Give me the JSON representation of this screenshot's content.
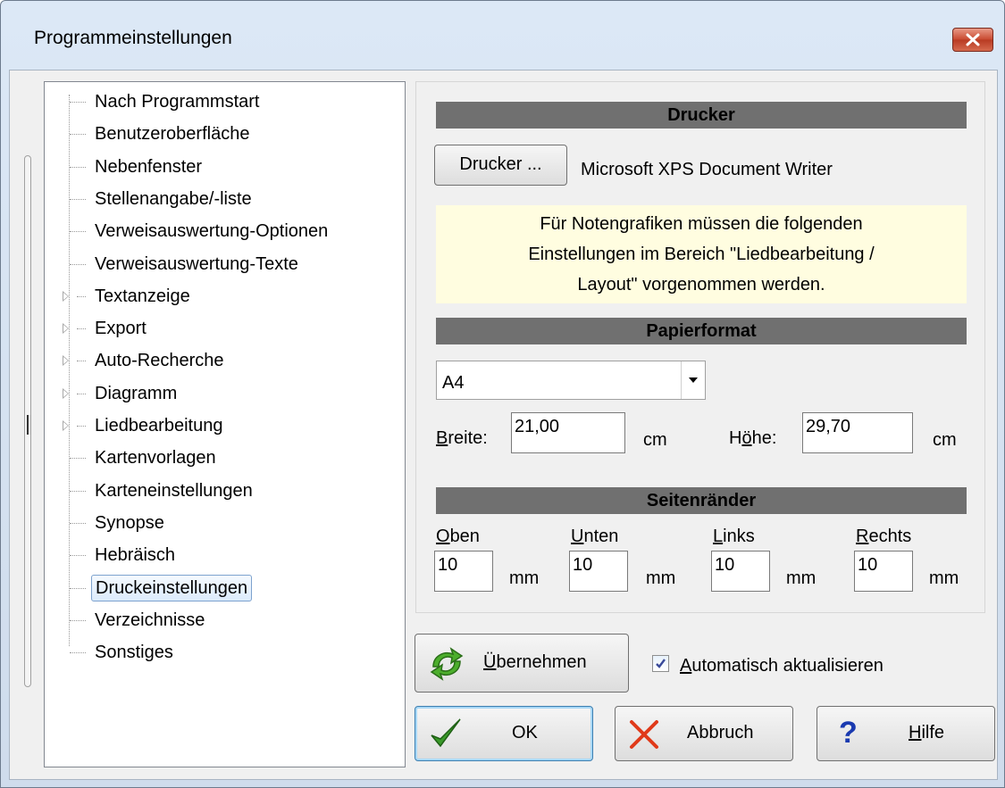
{
  "window": {
    "title": "Programmeinstellungen"
  },
  "tree": {
    "items": [
      {
        "label": "Nach Programmstart",
        "expandable": false
      },
      {
        "label": "Benutzeroberfläche",
        "expandable": false
      },
      {
        "label": "Nebenfenster",
        "expandable": false
      },
      {
        "label": "Stellenangabe/-liste",
        "expandable": false
      },
      {
        "label": "Verweisauswertung-Optionen",
        "expandable": false
      },
      {
        "label": "Verweisauswertung-Texte",
        "expandable": false
      },
      {
        "label": "Textanzeige",
        "expandable": true
      },
      {
        "label": "Export",
        "expandable": true
      },
      {
        "label": "Auto-Recherche",
        "expandable": true
      },
      {
        "label": "Diagramm",
        "expandable": true
      },
      {
        "label": "Liedbearbeitung",
        "expandable": true
      },
      {
        "label": "Kartenvorlagen",
        "expandable": false
      },
      {
        "label": "Karteneinstellungen",
        "expandable": false
      },
      {
        "label": "Synopse",
        "expandable": false
      },
      {
        "label": "Hebräisch",
        "expandable": false
      },
      {
        "label": "Druckeinstellungen",
        "expandable": false,
        "selected": true
      },
      {
        "label": "Verzeichnisse",
        "expandable": false
      },
      {
        "label": "Sonstiges",
        "expandable": false
      }
    ]
  },
  "printer": {
    "section_title": "Drucker",
    "button_label": "Drucker ...",
    "name": "Microsoft XPS Document Writer",
    "note_lines": [
      "Für Notengrafiken müssen die folgenden",
      "Einstellungen im Bereich \"Liedbearbeitung /",
      "Layout\" vorgenommen werden."
    ]
  },
  "paper": {
    "section_title": "Papierformat",
    "format": "A4",
    "width_label_u": "B",
    "width_label_rest": "reite:",
    "width": "21,00",
    "width_unit": "cm",
    "height_label_pre": "H",
    "height_label_u": "ö",
    "height_label_rest": "he:",
    "height": "29,70",
    "height_unit": "cm"
  },
  "margins": {
    "section_title": "Seitenränder",
    "top_u": "O",
    "top_rest": "ben",
    "top": "10",
    "bottom_u": "U",
    "bottom_rest": "nten",
    "bottom": "10",
    "left_u": "L",
    "left_rest": "inks",
    "left": "10",
    "right_u": "R",
    "right_rest": "echts",
    "right": "10",
    "unit": "mm"
  },
  "actions": {
    "apply_u": "Ü",
    "apply_rest": "bernehmen",
    "auto_update_u": "A",
    "auto_update_rest": "utomatisch aktualisieren",
    "auto_update_checked": true,
    "ok": "OK",
    "cancel": "Abbruch",
    "help_u": "H",
    "help_rest": "ilfe"
  },
  "colors": {
    "section_header": "#707070",
    "note_bg": "#fffde0",
    "close_button": "#c8482f",
    "ok_icon": "#3a9a2a",
    "cancel_icon": "#e03a1a",
    "help_icon": "#1a3ab0"
  }
}
